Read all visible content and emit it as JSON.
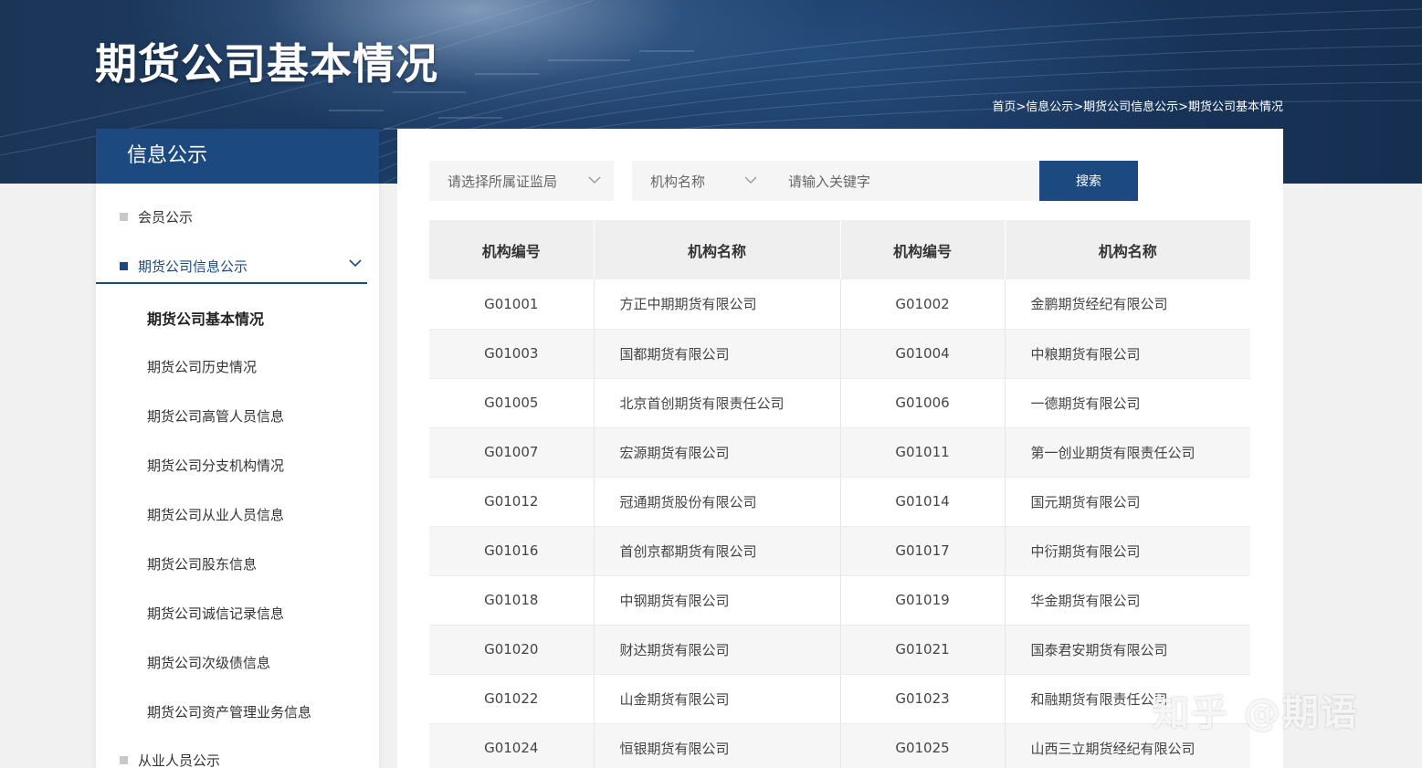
{
  "banner": {
    "title": "期货公司基本情况",
    "breadcrumb": "首页>信息公示>期货公司信息公示>期货公司基本情况"
  },
  "sidebar": {
    "header": "信息公示",
    "items": [
      {
        "label": "会员公示",
        "active": false
      },
      {
        "label": "期货公司信息公示",
        "active": true
      },
      {
        "label": "从业人员公示",
        "active": false
      }
    ],
    "sub_items": [
      {
        "label": "期货公司基本情况",
        "current": true
      },
      {
        "label": "期货公司历史情况"
      },
      {
        "label": "期货公司高管人员信息"
      },
      {
        "label": "期货公司分支机构情况"
      },
      {
        "label": "期货公司从业人员信息"
      },
      {
        "label": "期货公司股东信息"
      },
      {
        "label": "期货公司诚信记录信息"
      },
      {
        "label": "期货公司次级债信息"
      },
      {
        "label": "期货公司资产管理业务信息"
      }
    ]
  },
  "filters": {
    "regulator_placeholder": "请选择所属证监局",
    "field_select": "机构名称",
    "keyword_placeholder": "请输入关键字",
    "search_label": "搜索"
  },
  "table": {
    "headers": [
      "机构编号",
      "机构名称",
      "机构编号",
      "机构名称"
    ],
    "rows": [
      [
        "G01001",
        "方正中期期货有限公司",
        "G01002",
        "金鹏期货经纪有限公司"
      ],
      [
        "G01003",
        "国都期货有限公司",
        "G01004",
        "中粮期货有限公司"
      ],
      [
        "G01005",
        "北京首创期货有限责任公司",
        "G01006",
        "一德期货有限公司"
      ],
      [
        "G01007",
        "宏源期货有限公司",
        "G01011",
        "第一创业期货有限责任公司"
      ],
      [
        "G01012",
        "冠通期货股份有限公司",
        "G01014",
        "国元期货有限公司"
      ],
      [
        "G01016",
        "首创京都期货有限公司",
        "G01017",
        "中衍期货有限公司"
      ],
      [
        "G01018",
        "中钢期货有限公司",
        "G01019",
        "华金期货有限公司"
      ],
      [
        "G01020",
        "财达期货有限公司",
        "G01021",
        "国泰君安期货有限公司"
      ],
      [
        "G01022",
        "山金期货有限公司",
        "G01023",
        "和融期货有限责任公司"
      ],
      [
        "G01024",
        "恒银期货有限公司",
        "G01025",
        "山西三立期货经纪有限公司"
      ]
    ]
  },
  "watermark": "知乎 @期语",
  "colors": {
    "primary": "#1c4a80",
    "header_bg": "#efefef",
    "row_alt": "#f6f6f6"
  }
}
